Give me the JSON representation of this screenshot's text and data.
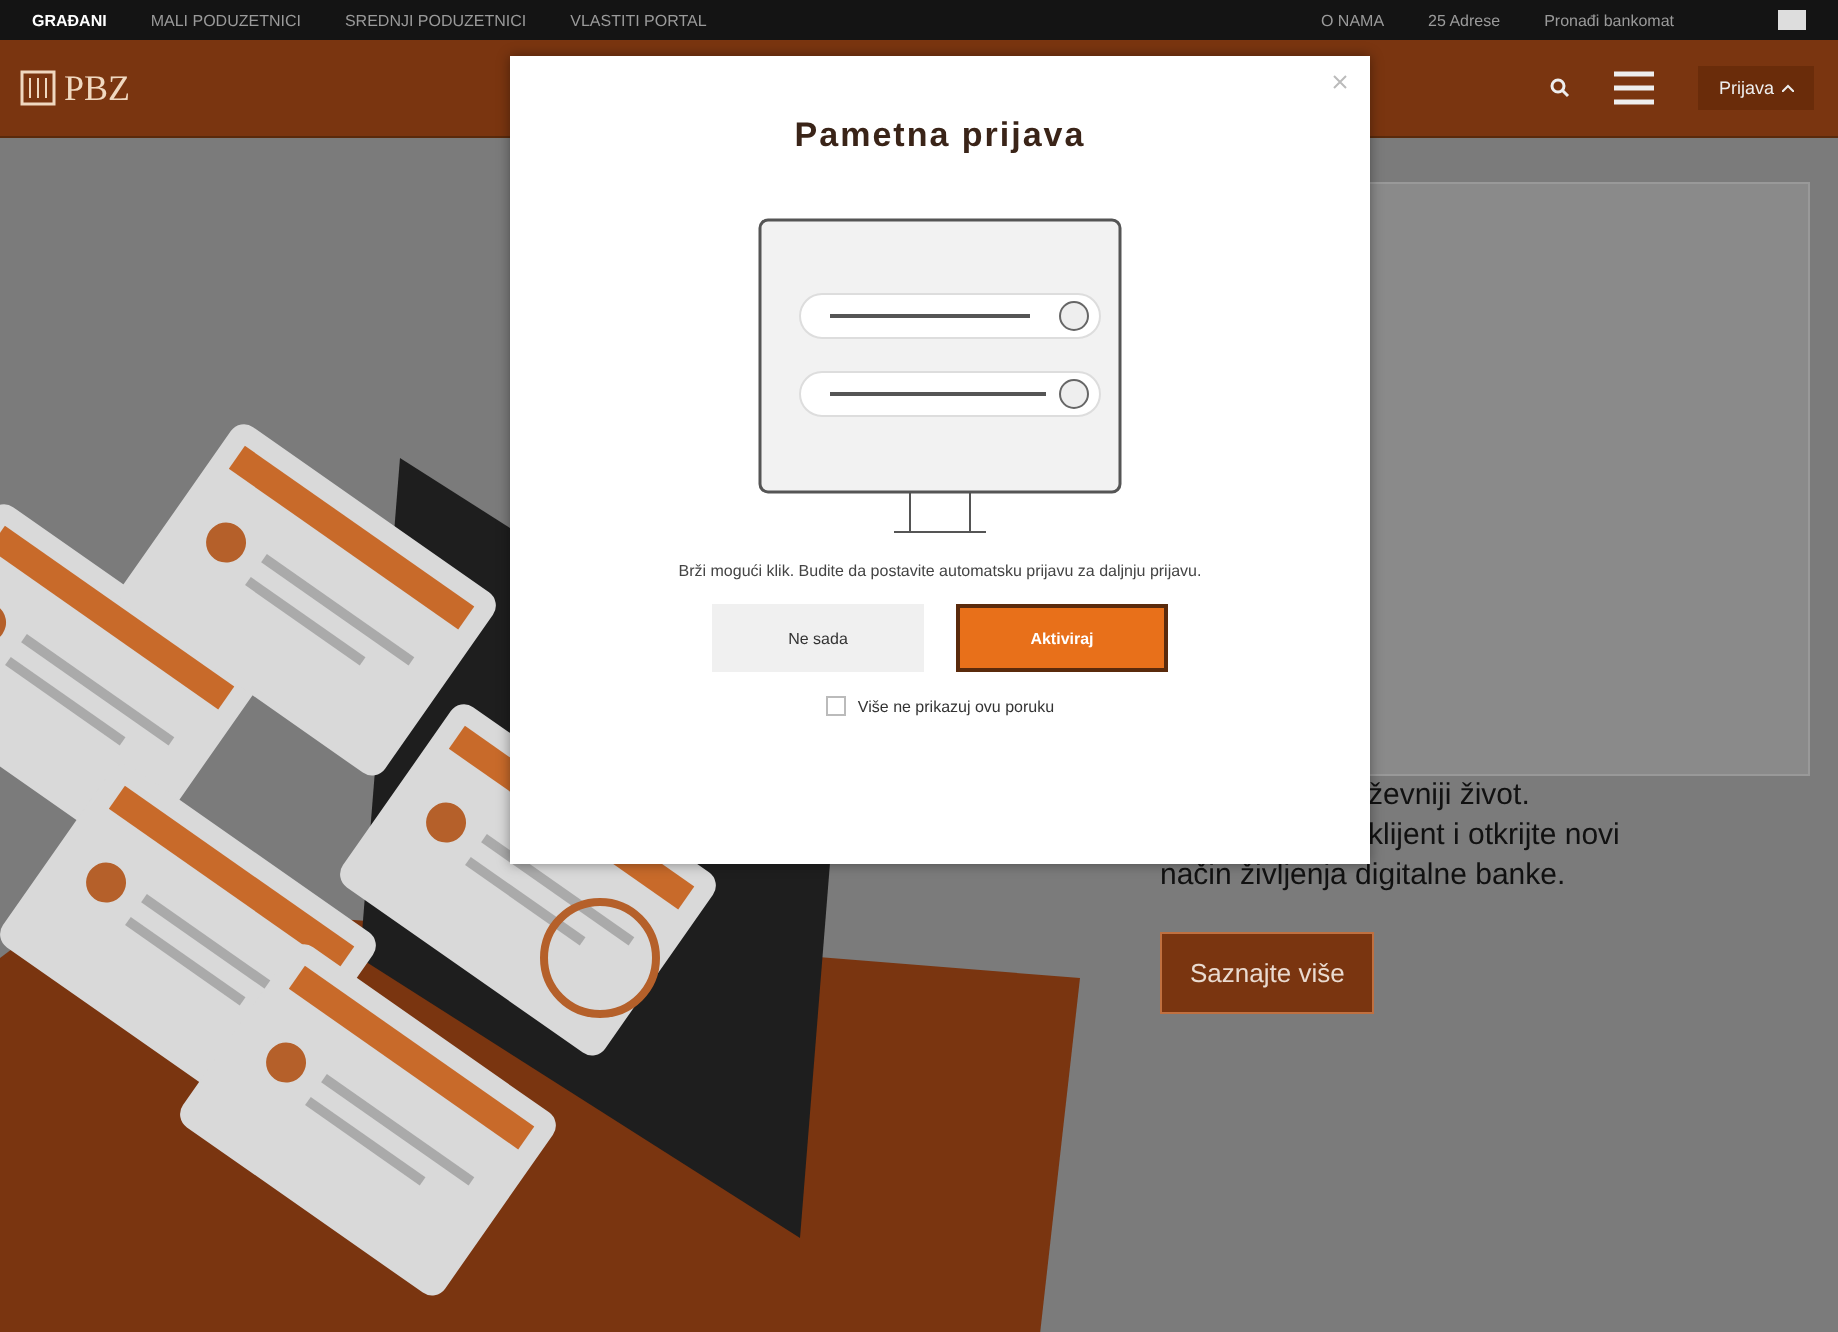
{
  "top_bar": {
    "links": [
      {
        "label": "GRAĐANI",
        "selected": true
      },
      {
        "label": "MALI PODUZETNICI",
        "selected": false
      },
      {
        "label": "SREDNJI PODUZETNICI",
        "selected": false
      },
      {
        "label": "VLASTITI PORTAL",
        "selected": false
      }
    ],
    "right_links": [
      "O NAMA",
      "25 Adrese",
      "Pronađi bankomat"
    ]
  },
  "header": {
    "logo": "PBZ",
    "login": "Prijava"
  },
  "hero": {
    "lines": [
      "ževniji život.",
      "klijent i otkrijte novi",
      "način življenja digitalne banke."
    ],
    "button": "Saznajte više"
  },
  "modal": {
    "title": "Pametna prijava",
    "message": "Brži mogući klik. Budite da postavite automatsku prijavu za daljnju prijavu.",
    "buttons": [
      {
        "label": "Ne sada",
        "kind": "secondary"
      },
      {
        "label": "Aktiviraj",
        "kind": "primary"
      }
    ],
    "checkbox": {
      "label": "Više ne prikazuj ovu poruku",
      "checked": false
    }
  }
}
